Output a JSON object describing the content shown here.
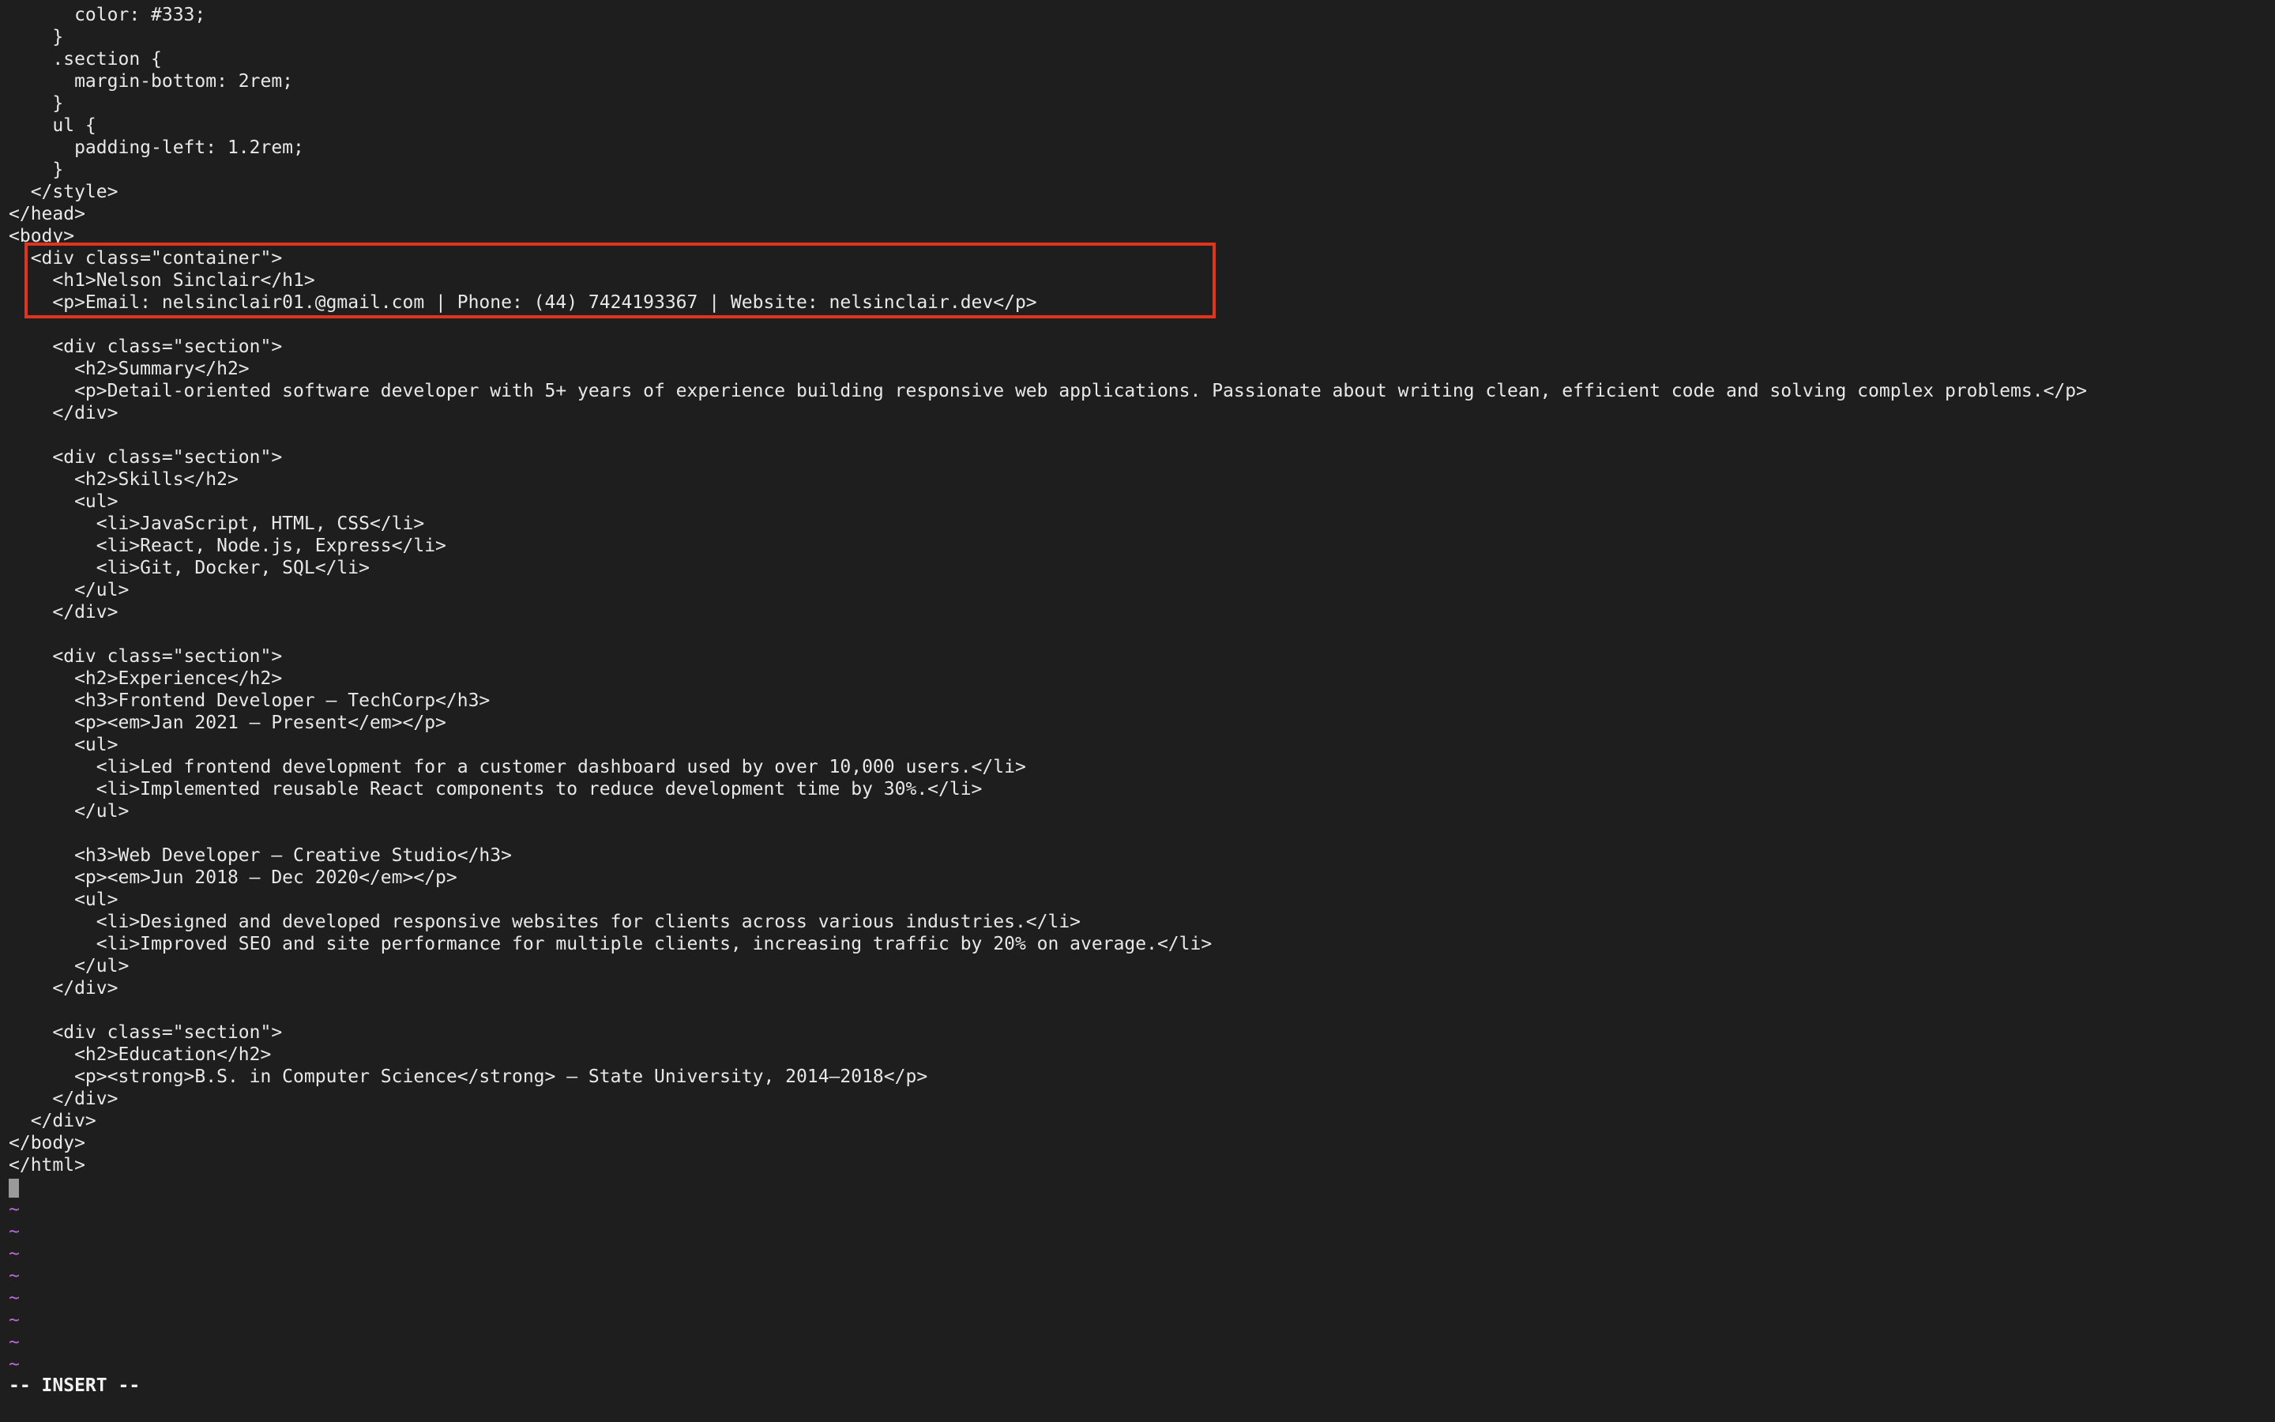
{
  "editor": {
    "lines": [
      "      color: #333;",
      "    }",
      "    .section {",
      "      margin-bottom: 2rem;",
      "    }",
      "    ul {",
      "      padding-left: 1.2rem;",
      "    }",
      "  </style>",
      "</head>",
      "<body>",
      "  <div class=\"container\">",
      "    <h1>Nelson Sinclair</h1>",
      "    <p>Email: nelsinclair01.@gmail.com | Phone: (44) 7424193367 | Website: nelsinclair.dev</p>",
      "",
      "    <div class=\"section\">",
      "      <h2>Summary</h2>",
      "      <p>Detail-oriented software developer with 5+ years of experience building responsive web applications. Passionate about writing clean, efficient code and solving complex problems.</p>",
      "    </div>",
      "",
      "    <div class=\"section\">",
      "      <h2>Skills</h2>",
      "      <ul>",
      "        <li>JavaScript, HTML, CSS</li>",
      "        <li>React, Node.js, Express</li>",
      "        <li>Git, Docker, SQL</li>",
      "      </ul>",
      "    </div>",
      "",
      "    <div class=\"section\">",
      "      <h2>Experience</h2>",
      "      <h3>Frontend Developer — TechCorp</h3>",
      "      <p><em>Jan 2021 — Present</em></p>",
      "      <ul>",
      "        <li>Led frontend development for a customer dashboard used by over 10,000 users.</li>",
      "        <li>Implemented reusable React components to reduce development time by 30%.</li>",
      "      </ul>",
      "",
      "      <h3>Web Developer — Creative Studio</h3>",
      "      <p><em>Jun 2018 — Dec 2020</em></p>",
      "      <ul>",
      "        <li>Designed and developed responsive websites for clients across various industries.</li>",
      "        <li>Improved SEO and site performance for multiple clients, increasing traffic by 20% on average.</li>",
      "      </ul>",
      "    </div>",
      "",
      "    <div class=\"section\">",
      "      <h2>Education</h2>",
      "      <p><strong>B.S. in Computer Science</strong> — State University, 2014–2018</p>",
      "    </div>",
      "  </div>",
      "</body>",
      "</html>"
    ],
    "empty_line_marker": "~",
    "mode_indicator": "-- INSERT --",
    "colors": {
      "background": "#1e1e1e",
      "text": "#e8e8e8",
      "tilde": "#b96ad9",
      "highlight_border": "#e0341e",
      "cursor": "#9a9a9a"
    }
  }
}
